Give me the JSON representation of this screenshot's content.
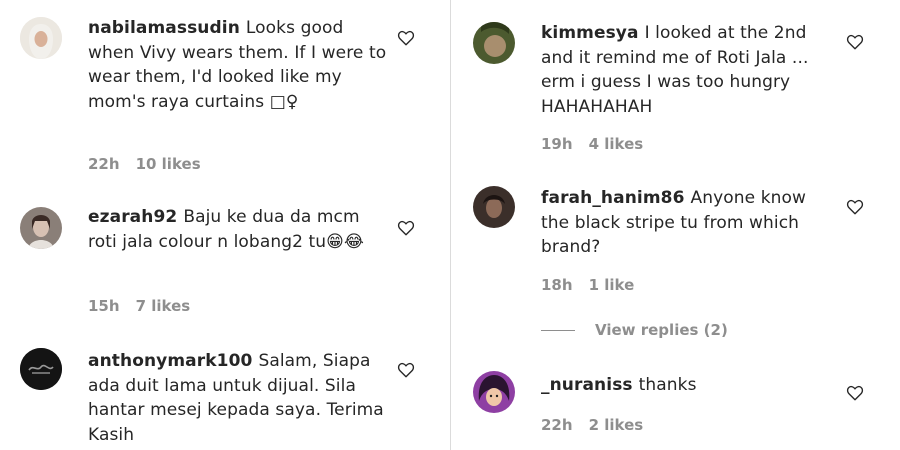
{
  "comments_left": [
    {
      "username": "nabilamassudin",
      "text": "Looks good when Vivy wears them. If I were to wear them, I'd looked like my mom's raya curtains □♀",
      "time": "22h",
      "likes": "10 likes",
      "avatar_icon": "hijab-woman-avatar"
    },
    {
      "username": "ezarah92",
      "text": "Baju ke dua da mcm roti jala colour n lobang2 tu😁😂",
      "time": "15h",
      "likes": "7 likes",
      "avatar_icon": "person-photo-avatar"
    },
    {
      "username": "anthonymark100",
      "text": "Salam, Siapa ada duit lama untuk dijual. Sila hantar mesej kepada saya. Terima Kasih",
      "avatar_icon": "dark-logo-avatar"
    }
  ],
  "comments_right": [
    {
      "username": "kimmesya",
      "text": "I looked at the 2nd and it remind me of Roti Jala ... erm i guess I was too hungry HAHAHAHAH",
      "time": "19h",
      "likes": "4 likes",
      "avatar_icon": "green-photo-avatar"
    },
    {
      "username": "farah_hanim86",
      "text": "Anyone know the black stripe tu from which brand?",
      "time": "18h",
      "likes": "1 like",
      "view_replies": "View replies (2)",
      "avatar_icon": "dark-photo-avatar"
    },
    {
      "username": "_nuraniss",
      "text": "thanks",
      "time": "22h",
      "likes": "2 likes",
      "avatar_icon": "cartoon-girl-avatar"
    }
  ],
  "colors": {
    "text": "#262626",
    "meta": "#8e8e8e",
    "divider": "#dbdbdb"
  }
}
